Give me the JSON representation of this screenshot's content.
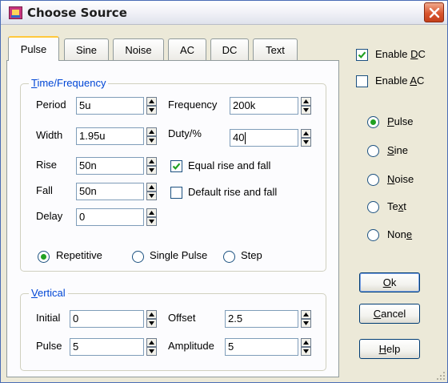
{
  "window": {
    "title": "Choose Source"
  },
  "tabs": [
    {
      "label": "Pulse",
      "active": true
    },
    {
      "label": "Sine"
    },
    {
      "label": "Noise"
    },
    {
      "label": "AC"
    },
    {
      "label": "DC"
    },
    {
      "label": "Text"
    }
  ],
  "time_frequency": {
    "group_label_mnemonic": "T",
    "group_label_rest": "ime/Frequency",
    "period": {
      "label": "Period",
      "value": "5u"
    },
    "width": {
      "label": "Width",
      "value": "1.95u"
    },
    "rise": {
      "label": "Rise",
      "value": "50n"
    },
    "fall": {
      "label": "Fall",
      "value": "50n"
    },
    "delay": {
      "label": "Delay",
      "value": "0"
    },
    "frequency": {
      "label": "Frequency",
      "value": "200k"
    },
    "duty": {
      "label": "Duty/%",
      "value": "40"
    },
    "equal_rise_fall": {
      "label": "Equal rise and fall",
      "checked": true
    },
    "default_rise_fall": {
      "label": "Default rise and fall",
      "checked": false
    },
    "modes": [
      {
        "label": "Repetitive",
        "selected": true
      },
      {
        "label": "Single Pulse",
        "selected": false
      },
      {
        "label": "Step",
        "selected": false
      }
    ]
  },
  "vertical": {
    "group_label_mnemonic": "V",
    "group_label_rest": "ertical",
    "initial": {
      "label": "Initial",
      "value": "0"
    },
    "pulse": {
      "label": "Pulse",
      "value": "5"
    },
    "offset": {
      "label": "Offset",
      "value": "2.5"
    },
    "amplitude": {
      "label": "Amplitude",
      "value": "5"
    }
  },
  "side": {
    "enable_dc": {
      "pre": "Enable ",
      "mnemonic": "D",
      "post": "C",
      "checked": true
    },
    "enable_ac": {
      "pre": "Enable ",
      "mnemonic": "A",
      "post": "C",
      "checked": false
    },
    "source_types": [
      {
        "pre": "",
        "mnemonic": "P",
        "post": "ulse",
        "selected": true
      },
      {
        "pre": "",
        "mnemonic": "S",
        "post": "ine",
        "selected": false
      },
      {
        "pre": "",
        "mnemonic": "N",
        "post": "oise",
        "selected": false
      },
      {
        "pre": "Te",
        "mnemonic": "x",
        "post": "t",
        "selected": false
      },
      {
        "pre": "Non",
        "mnemonic": "e",
        "post": "",
        "selected": false
      }
    ]
  },
  "buttons": {
    "ok": {
      "mnemonic": "O",
      "rest": "k"
    },
    "cancel": {
      "mnemonic": "C",
      "rest": "ancel"
    },
    "help": {
      "mnemonic": "H",
      "rest": "elp"
    }
  },
  "colors": {
    "accent_blue": "#0046d5",
    "check_green": "#21a121",
    "close_red": "#d9552e",
    "tab_highlight": "#ffc83c"
  }
}
